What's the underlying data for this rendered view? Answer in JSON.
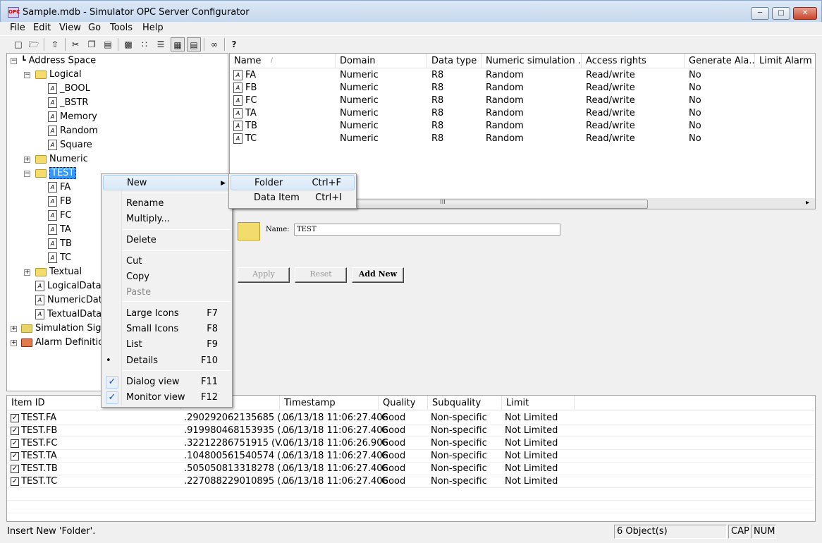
{
  "window": {
    "title": "Sample.mdb - Simulator OPC Server Configurator",
    "app_icon_text": "OPC"
  },
  "menubar": [
    "File",
    "Edit",
    "View",
    "Go",
    "Tools",
    "Help"
  ],
  "toolbar": {
    "buttons": [
      "new-icon",
      "open-icon",
      "up-folder-icon",
      "cut-icon",
      "copy-icon",
      "paste-icon",
      "large-icons-icon",
      "small-icons-icon",
      "list-icon",
      "details-icon",
      "dialog-view-icon",
      "monitor-view-icon",
      "glasses-icon",
      "help-icon"
    ]
  },
  "tree": {
    "root": "Address Space",
    "logical": "Logical",
    "logical_items": [
      "_BOOL",
      "_BSTR",
      "Memory",
      "Random",
      "Square"
    ],
    "numeric": "Numeric",
    "test": "TEST",
    "test_items": [
      "FA",
      "FB",
      "FC",
      "TA",
      "TB",
      "TC"
    ],
    "textual": "Textual",
    "data_items": [
      "LogicalDataIt",
      "NumericData",
      "TextualDataIt"
    ],
    "simulation": "Simulation Signa",
    "alarm": "Alarm Definition"
  },
  "list": {
    "columns": [
      "Name",
      "Domain",
      "Data type",
      "Numeric simulation ...",
      "Access rights",
      "Generate Ala...",
      "Limit Alarm De"
    ],
    "rows": [
      [
        "FA",
        "Numeric",
        "R8",
        "Random",
        "Read/write",
        "No"
      ],
      [
        "FB",
        "Numeric",
        "R8",
        "Random",
        "Read/write",
        "No"
      ],
      [
        "FC",
        "Numeric",
        "R8",
        "Random",
        "Read/write",
        "No"
      ],
      [
        "TA",
        "Numeric",
        "R8",
        "Random",
        "Read/write",
        "No"
      ],
      [
        "TB",
        "Numeric",
        "R8",
        "Random",
        "Read/write",
        "No"
      ],
      [
        "TC",
        "Numeric",
        "R8",
        "Random",
        "Read/write",
        "No"
      ]
    ],
    "scroll_grip": "III"
  },
  "dialog": {
    "name_label": "Name:",
    "name_value": "TEST",
    "apply": "Apply",
    "reset": "Reset",
    "add_new": "Add New"
  },
  "monitor": {
    "columns": [
      "Item ID",
      "",
      "Timestamp",
      "Quality",
      "Subquality",
      "Limit"
    ],
    "rows": [
      [
        "TEST.FA",
        ".290292062135685 (...",
        "06/13/18 11:06:27.406",
        "Good",
        "Non-specific",
        "Not Limited"
      ],
      [
        "TEST.FB",
        ".919980468153935 (...",
        "06/13/18 11:06:27.406",
        "Good",
        "Non-specific",
        "Not Limited"
      ],
      [
        "TEST.FC",
        ".32212286751915 (V...",
        "06/13/18 11:06:26.906",
        "Good",
        "Non-specific",
        "Not Limited"
      ],
      [
        "TEST.TA",
        ".104800561540574 (...",
        "06/13/18 11:06:27.406",
        "Good",
        "Non-specific",
        "Not Limited"
      ],
      [
        "TEST.TB",
        ".505050813318278 (...",
        "06/13/18 11:06:27.406",
        "Good",
        "Non-specific",
        "Not Limited"
      ],
      [
        "TEST.TC",
        ".227088229010895 (...",
        "06/13/18 11:06:27.406",
        "Good",
        "Non-specific",
        "Not Limited"
      ]
    ]
  },
  "context_menu": {
    "items": [
      {
        "label": "New",
        "accel": "",
        "submenu": true
      },
      {
        "label": "Rename",
        "accel": ""
      },
      {
        "label": "Multiply...",
        "accel": ""
      },
      {
        "label": "Delete",
        "accel": ""
      },
      {
        "label": "Cut",
        "accel": ""
      },
      {
        "label": "Copy",
        "accel": ""
      },
      {
        "label": "Paste",
        "accel": "",
        "disabled": true
      },
      {
        "label": "Large Icons",
        "accel": "F7"
      },
      {
        "label": "Small Icons",
        "accel": "F8"
      },
      {
        "label": "List",
        "accel": "F9"
      },
      {
        "label": "Details",
        "accel": "F10",
        "bullet": true
      },
      {
        "label": "Dialog view",
        "accel": "F11",
        "checked": true
      },
      {
        "label": "Monitor view",
        "accel": "F12",
        "checked": true
      }
    ]
  },
  "submenu": {
    "items": [
      {
        "label": "Folder",
        "accel": "Ctrl+F"
      },
      {
        "label": "Data Item",
        "accel": "Ctrl+I"
      }
    ]
  },
  "statusbar": {
    "message": "Insert New 'Folder'.",
    "objects": "6 Object(s)",
    "cap": "CAP",
    "num": "NUM"
  },
  "colors": {
    "selection": "#3399ff",
    "folder": "#f3dc6b",
    "menu_highlight": "#d9e8f9"
  }
}
